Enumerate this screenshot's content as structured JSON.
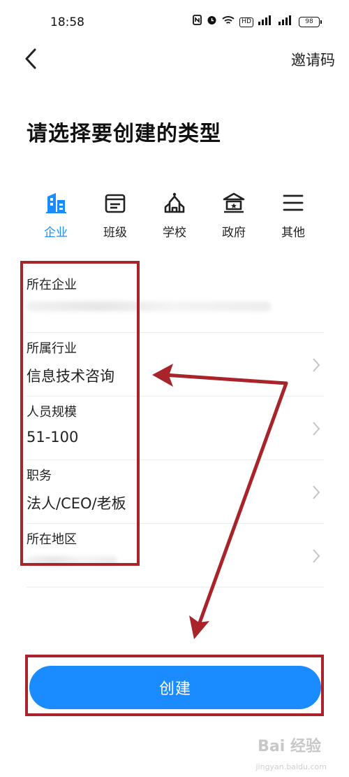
{
  "status_bar": {
    "time": "18:58",
    "icons": [
      "nfc-icon",
      "alarm-icon",
      "wifi-icon",
      "hd-icon",
      "signal-4g-icon",
      "signal-4g-icon"
    ],
    "hd_label": "HD",
    "battery": "98"
  },
  "nav": {
    "back_icon": "chevron-left-icon",
    "invite_label": "邀请码"
  },
  "title": "请选择要创建的类型",
  "type_tabs": [
    {
      "label": "企业",
      "icon": "building-icon",
      "active": true
    },
    {
      "label": "班级",
      "icon": "classroom-icon",
      "active": false
    },
    {
      "label": "学校",
      "icon": "school-icon",
      "active": false
    },
    {
      "label": "政府",
      "icon": "government-icon",
      "active": false
    },
    {
      "label": "其他",
      "icon": "menu-icon",
      "active": false
    }
  ],
  "form": {
    "company": {
      "label": "所在企业",
      "value": ""
    },
    "industry": {
      "label": "所属行业",
      "value": "信息技术咨询"
    },
    "size": {
      "label": "人员规模",
      "value": "51-100"
    },
    "position": {
      "label": "职务",
      "value": "法人/CEO/老板"
    },
    "region": {
      "label": "所在地区",
      "value": ""
    }
  },
  "create_button": "创建",
  "colors": {
    "accent": "#1a8cff",
    "annotation": "#a8232a"
  },
  "watermark": {
    "text": "Bai 经验",
    "sub": "jingyan.baidu.com"
  }
}
